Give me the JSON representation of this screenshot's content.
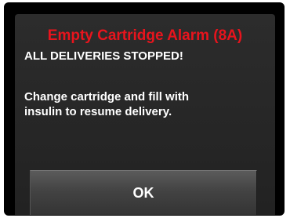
{
  "alarm": {
    "title": "Empty Cartridge Alarm (8A)",
    "subtitle": "ALL DELIVERIES STOPPED!",
    "message_line1": "Change cartridge and fill with",
    "message_line2": "insulin to resume delivery.",
    "ok_label": "OK"
  },
  "colors": {
    "title": "#e8141d",
    "text": "#ffffff",
    "background": "#000000",
    "panel": "#2c2c2c",
    "button": "#4a4a4a"
  }
}
